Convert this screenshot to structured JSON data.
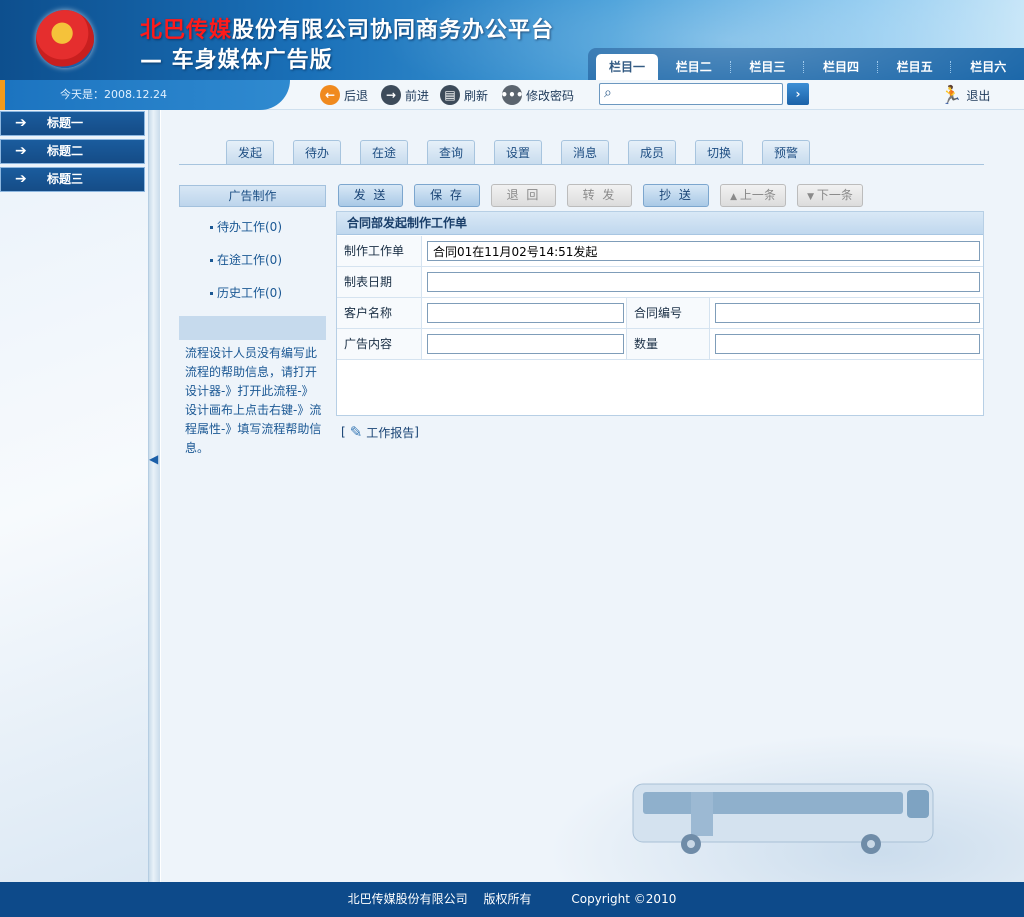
{
  "header": {
    "title_redacted": "北巴传媒",
    "title_rest": "股份有限公司协同商务办公平台",
    "subtitle": "— 车身媒体广告版",
    "nav": [
      "栏目一",
      "栏目二",
      "栏目三",
      "栏目四",
      "栏目五",
      "栏目六"
    ]
  },
  "toolbar": {
    "date_text": "今天是：2008.12.24",
    "back": "后退",
    "forward": "前进",
    "refresh": "刷新",
    "change_password": "修改密码",
    "search_placeholder": "",
    "logout": "退出"
  },
  "sidebar": {
    "items": [
      "标题一",
      "标题二",
      "标题三"
    ]
  },
  "main": {
    "tabs": [
      "发起",
      "待办",
      "在途",
      "查询",
      "设置",
      "消息",
      "成员",
      "切换",
      "预警"
    ],
    "panel": {
      "title": "广告制作",
      "links": [
        "待办工作(0)",
        "在途工作(0)",
        "历史工作(0)"
      ],
      "help": "流程设计人员没有编写此流程的帮助信息，请打开设计器-》打开此流程-》设计画布上点击右键-》流程属性-》填写流程帮助信息。"
    },
    "actions": [
      {
        "label": "发 送",
        "enabled": true
      },
      {
        "label": "保 存",
        "enabled": true
      },
      {
        "label": "退 回",
        "enabled": false
      },
      {
        "label": "转 发",
        "enabled": false
      },
      {
        "label": "抄 送",
        "enabled": true
      },
      {
        "label": "上一条",
        "enabled": false
      },
      {
        "label": "下一条",
        "enabled": false
      }
    ],
    "form": {
      "title": "合同部发起制作工作单",
      "label_worksheet": "制作工作单",
      "value_worksheet": "合同01在11月02号14:51发起",
      "label_date": "制表日期",
      "value_date": "",
      "label_customer": "客户名称",
      "value_customer": "",
      "label_contract": "合同编号",
      "value_contract": "",
      "label_content": "广告内容",
      "value_content": "",
      "label_quantity": "数量",
      "value_quantity": ""
    },
    "report_label": "工作报告"
  },
  "footer": {
    "company": "北巴传媒股份有限公司",
    "rights": "版权所有",
    "copyright": "Copyright ©2010"
  },
  "colors": {
    "brand_blue": "#0d4a8a",
    "accent_orange": "#f39a1a"
  }
}
